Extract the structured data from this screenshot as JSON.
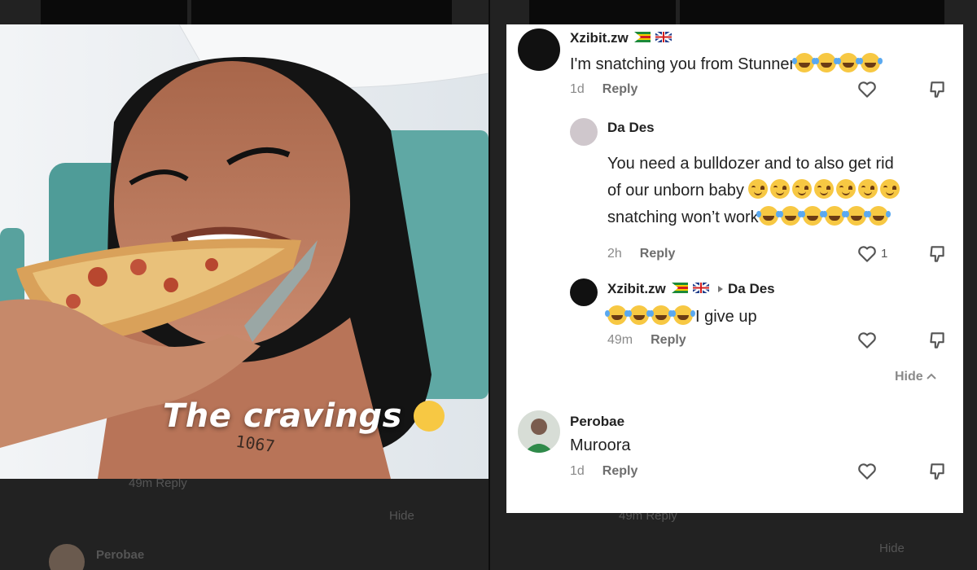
{
  "left": {
    "caption": "The cravings",
    "bg_meta": "49m  Reply",
    "bg_hide": "Hide",
    "bg_name": "Perobae"
  },
  "right": {
    "bg_meta": "49m  Reply",
    "bg_hide": "Hide"
  },
  "comments": [
    {
      "name": "Xzibit.zw",
      "text": "I'm snatching you from Stunner",
      "time": "1d",
      "reply": "Reply"
    },
    {
      "name": "Da Des",
      "text_line1": "You need a bulldozer and to also get rid",
      "text_line2": "of our unborn baby",
      "text_line3": "snatching won’t work",
      "time": "2h",
      "reply": "Reply",
      "likes": "1"
    },
    {
      "name": "Xzibit.zw",
      "reply_to": "Da Des",
      "text": "I give up",
      "time": "49m",
      "reply": "Reply"
    },
    {
      "name": "Perobae",
      "text": "Muroora",
      "time": "1d",
      "reply": "Reply"
    }
  ],
  "hide_label": "Hide",
  "icons": [
    "heart-icon",
    "dislike-icon",
    "chevron-up-icon",
    "play-triangle-icon",
    "laughing-emoji-icon",
    "relieved-emoji-icon",
    "crying-emoji-icon",
    "zimbabwe-flag-icon",
    "uk-flag-icon"
  ]
}
